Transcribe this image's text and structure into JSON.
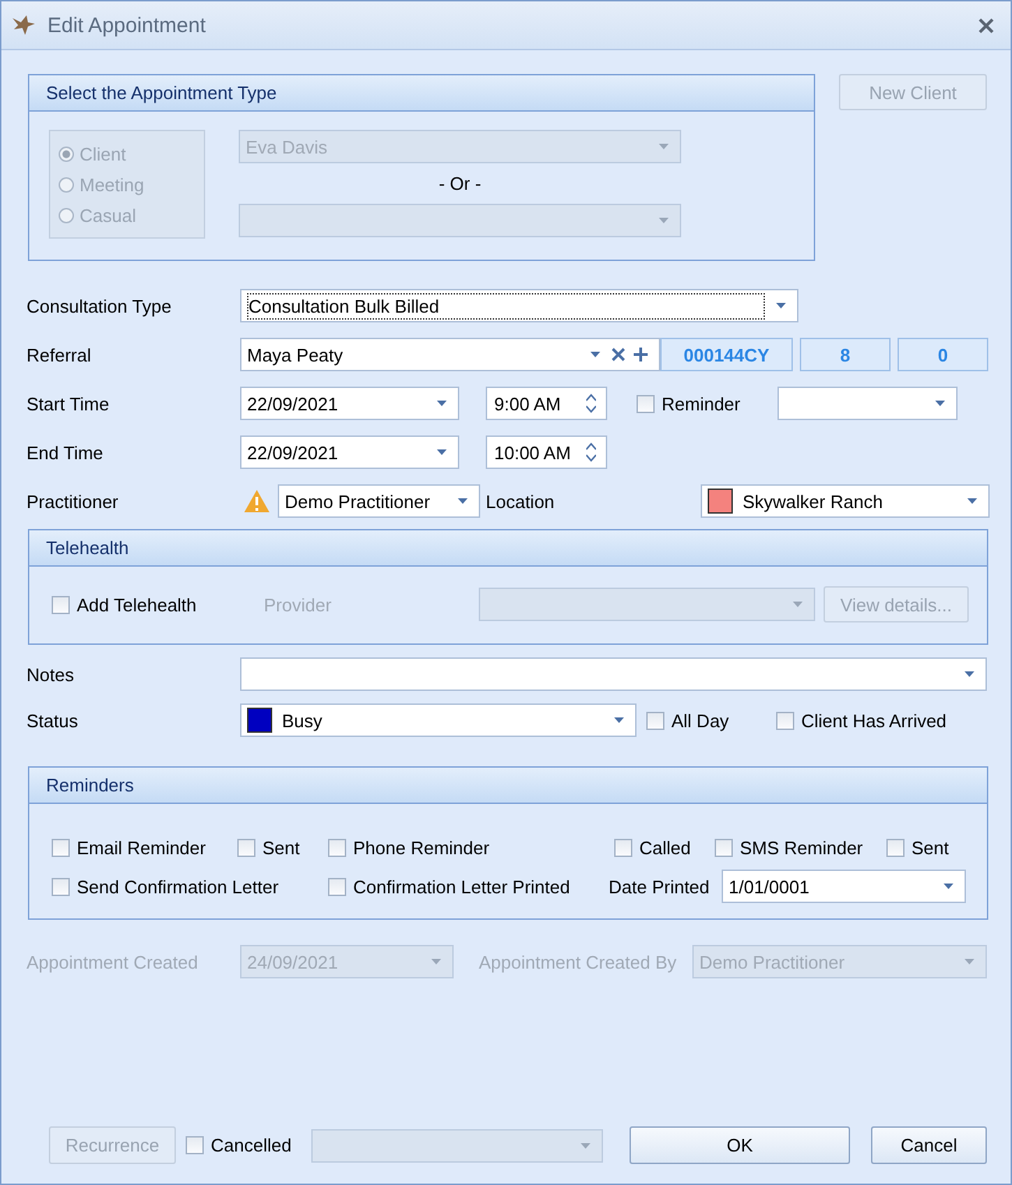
{
  "window": {
    "title": "Edit Appointment"
  },
  "appointment_type": {
    "title": "Select the Appointment Type",
    "disabled": true,
    "options": [
      {
        "label": "Client",
        "selected": true
      },
      {
        "label": "Meeting",
        "selected": false
      },
      {
        "label": "Casual",
        "selected": false
      }
    ],
    "client": "Eva Davis",
    "separator": "- Or -"
  },
  "new_client_button": {
    "label": "New Client",
    "disabled": true
  },
  "consultation_type": {
    "label": "Consultation Type",
    "value": "Consultation Bulk Billed"
  },
  "referral": {
    "label": "Referral",
    "value": "Maya Peaty",
    "codes": [
      "000144CY",
      "8",
      "0"
    ]
  },
  "start": {
    "label": "Start Time",
    "date": "22/09/2021",
    "time": "9:00 AM"
  },
  "reminder": {
    "label": "Reminder",
    "checked": false
  },
  "end": {
    "label": "End Time",
    "date": "22/09/2021",
    "time": "10:00 AM"
  },
  "practitioner": {
    "label": "Practitioner",
    "value": "Demo Practitioner",
    "warning": true
  },
  "location": {
    "label": "Location",
    "value": "Skywalker Ranch",
    "color": "#f4827e"
  },
  "telehealth": {
    "title": "Telehealth",
    "add": {
      "label": "Add Telehealth",
      "checked": false
    },
    "provider_label": "Provider",
    "provider_disabled": true,
    "view_details": {
      "label": "View details...",
      "disabled": true
    }
  },
  "notes": {
    "label": "Notes"
  },
  "status": {
    "label": "Status",
    "value": "Busy",
    "color": "#0000c0"
  },
  "all_day": {
    "label": "All Day",
    "checked": false
  },
  "client_arrived": {
    "label": "Client Has Arrived",
    "checked": false
  },
  "reminders": {
    "title": "Reminders",
    "row_1": [
      {
        "label": "Email Reminder",
        "checked": false
      },
      {
        "label": "Sent",
        "checked": false
      },
      {
        "label": "Phone Reminder",
        "checked": false
      },
      {
        "label": "Called",
        "checked": false
      },
      {
        "label": "SMS Reminder",
        "checked": false
      },
      {
        "label": "Sent",
        "checked": false
      }
    ],
    "row_2": [
      {
        "label": "Send Confirmation Letter",
        "checked": false
      },
      {
        "label": "Confirmation Letter Printed",
        "checked": false
      }
    ],
    "date_printed": {
      "label": "Date Printed",
      "value": "1/01/0001"
    }
  },
  "created": {
    "label": "Appointment Created",
    "value": "24/09/2021",
    "by_label": "Appointment Created By",
    "by_value": "Demo Practitioner",
    "disabled": true
  },
  "footer": {
    "recurrence": {
      "label": "Recurrence",
      "disabled": true
    },
    "cancelled": {
      "label": "Cancelled",
      "checked": false
    },
    "cancel_reason_disabled": true,
    "ok": {
      "label": "OK"
    },
    "cancel": {
      "label": "Cancel"
    }
  }
}
